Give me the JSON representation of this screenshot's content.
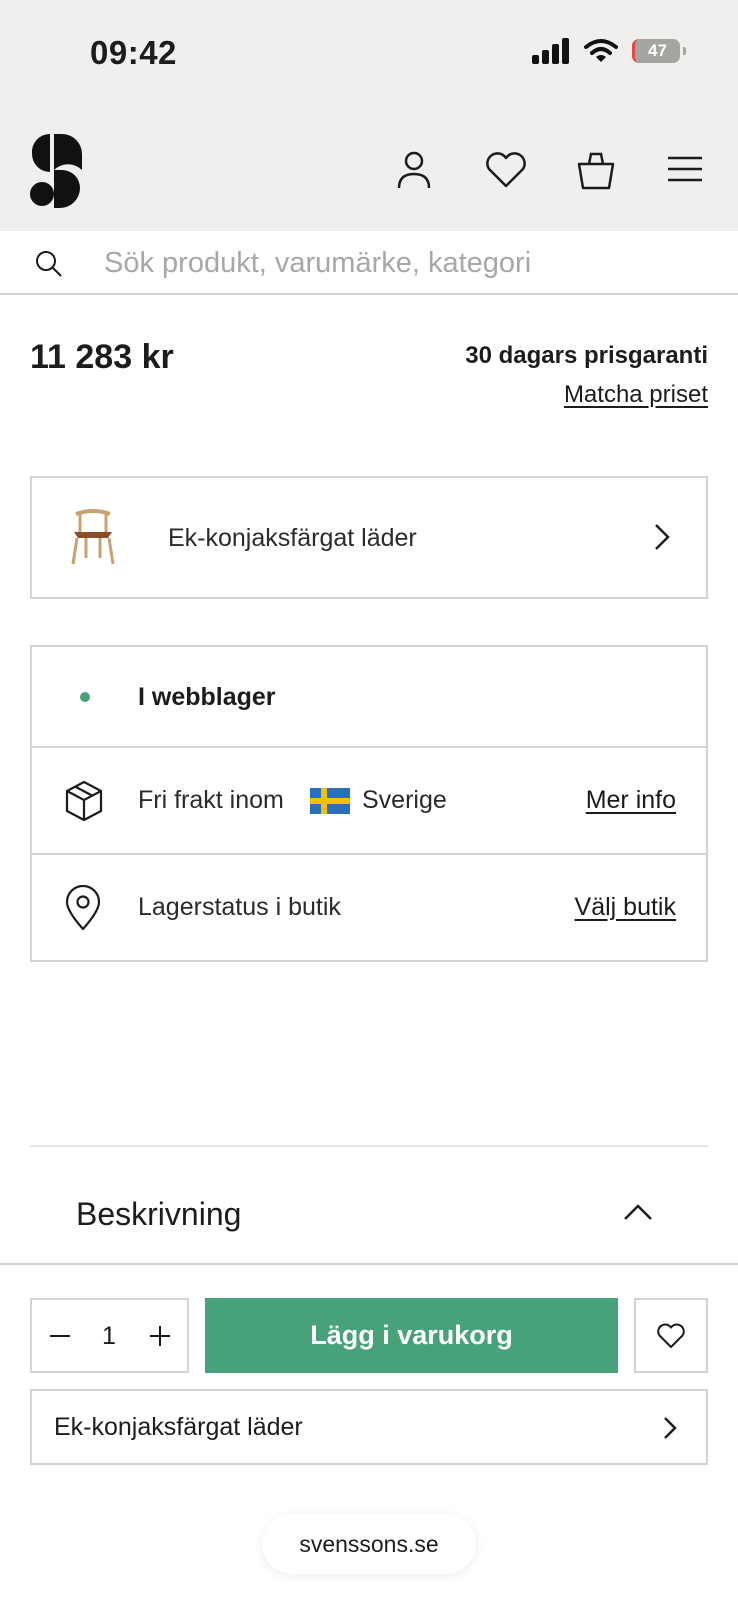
{
  "status_bar": {
    "time": "09:42",
    "battery": "47",
    "icons": [
      "signal-icon",
      "wifi-icon",
      "battery-icon"
    ]
  },
  "header": {
    "icons": [
      "logo-icon",
      "account-icon",
      "heart-icon",
      "bag-icon",
      "menu-icon"
    ]
  },
  "search": {
    "placeholder": "Sök produkt, varumärke, kategori",
    "icon": "search-icon"
  },
  "product": {
    "price": "11 283 kr",
    "guarantee": "30 dagars prisgaranti",
    "match_link": "Matcha priset",
    "variant": "Ek-konjaksfärgat läder"
  },
  "availability": {
    "stock_status": "I webblager",
    "stock_color": "#48a279",
    "shipping_text": "Fri frakt inom",
    "shipping_country": "Sverige",
    "shipping_link": "Mer info",
    "store_text": "Lagerstatus i butik",
    "store_link": "Välj butik"
  },
  "description": {
    "title": "Beskrivning"
  },
  "cart_bar": {
    "quantity": "1",
    "add_label": "Lägg i varukorg",
    "accent": "#48a279",
    "variant": "Ek-konjaksfärgat läder"
  },
  "browser": {
    "url": "svenssons.se"
  }
}
